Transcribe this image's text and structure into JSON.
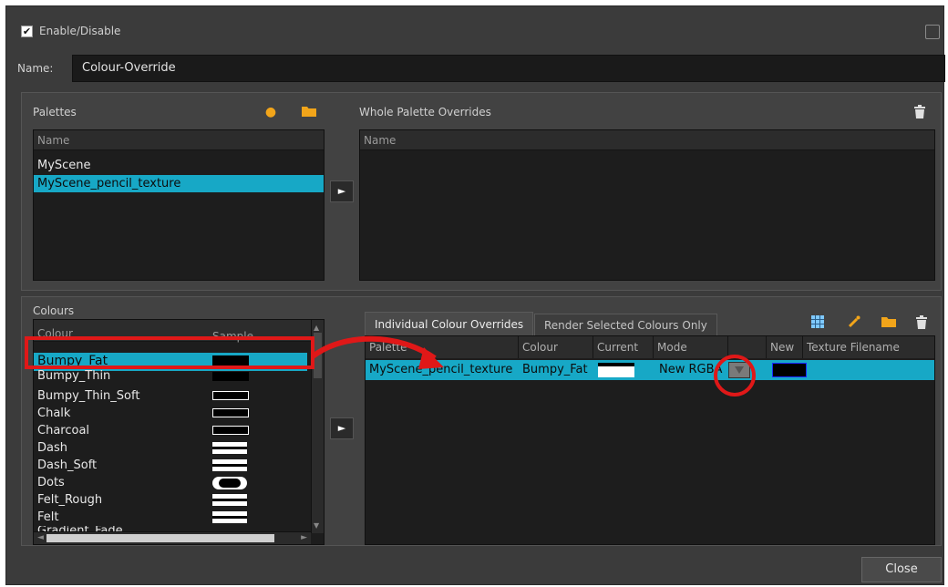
{
  "header": {
    "enable_label": "Enable/Disable",
    "enable_checked": true,
    "name_label": "Name:",
    "name_value": "Colour-Override"
  },
  "palettes": {
    "title": "Palettes",
    "column": "Name",
    "items": [
      "MyScene",
      "MyScene_pencil_texture"
    ],
    "selected": 1
  },
  "whole_overrides": {
    "title": "Whole Palette Overrides",
    "column": "Name"
  },
  "colours": {
    "title": "Colours",
    "col_colour": "Colour",
    "col_sample": "Sample",
    "items": [
      "Bumpy_Fat",
      "Bumpy_Thin",
      "Bumpy_Thin_Soft",
      "Chalk",
      "Charcoal",
      "Dash",
      "Dash_Soft",
      "Dots",
      "Felt_Rough",
      "Felt",
      "Gradient_Fade"
    ],
    "selected": 0
  },
  "tabs": {
    "individual": "Individual Colour Overrides",
    "render_selected": "Render Selected Colours Only"
  },
  "overrides_table": {
    "columns": [
      "Palette",
      "Colour",
      "Current",
      "Mode",
      "",
      "New",
      "Texture Filename"
    ],
    "rows": [
      {
        "palette": "MyScene_pencil_texture",
        "colour": "Bumpy_Fat",
        "mode": "New RGBA",
        "texture": ""
      }
    ]
  },
  "buttons": {
    "close": "Close",
    "add_arrow": "►"
  },
  "colors": {
    "selection": "#17a8c6",
    "annotation_red": "#e01818",
    "icon_orange": "#f2a51a"
  }
}
